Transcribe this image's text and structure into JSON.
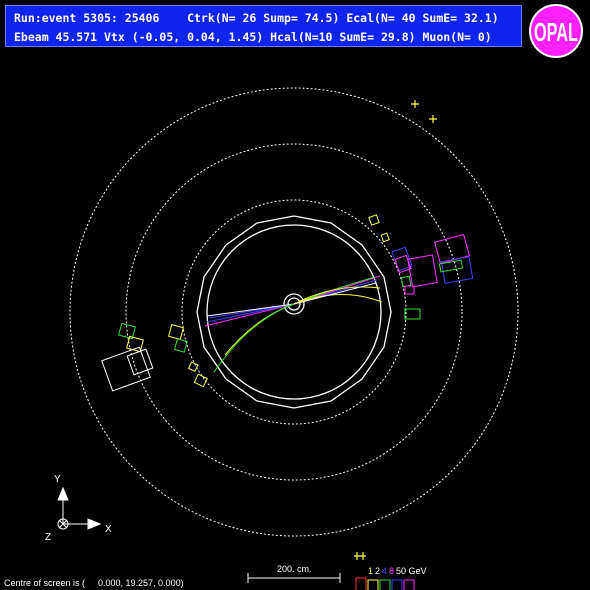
{
  "header": {
    "line1": "Run:event 5305: 25406    Ctrk(N= 26 Sump= 74.5) Ecal(N= 40 SumE= 32.1)",
    "line2": "Ebeam 45.571 Vtx (-0.05, 0.04, 1.45) Hcal(N=10 SumE= 29.8) Muon(N= 0)"
  },
  "logo": {
    "text": "OPAL"
  },
  "axes": {
    "y": "Y",
    "x": "X",
    "z": "Z"
  },
  "footer": {
    "centre_label": "Centre of screen is (",
    "centre_values": "0.000,  19.257,   0.000)",
    "scale_label": "200. cm.",
    "energy_scale": [
      "1",
      "2",
      "4",
      "8",
      "50 GeV"
    ]
  },
  "colors": {
    "background": "#000000",
    "info_box": "#1024f0",
    "dotted_rings": "#ffffff",
    "track_yellow": "#ffff40",
    "track_green": "#30e030",
    "track_blue": "#4040ff",
    "track_magenta": "#ff30ff",
    "ecal_green": "#20d020",
    "hcal_white": "#ffffff"
  }
}
